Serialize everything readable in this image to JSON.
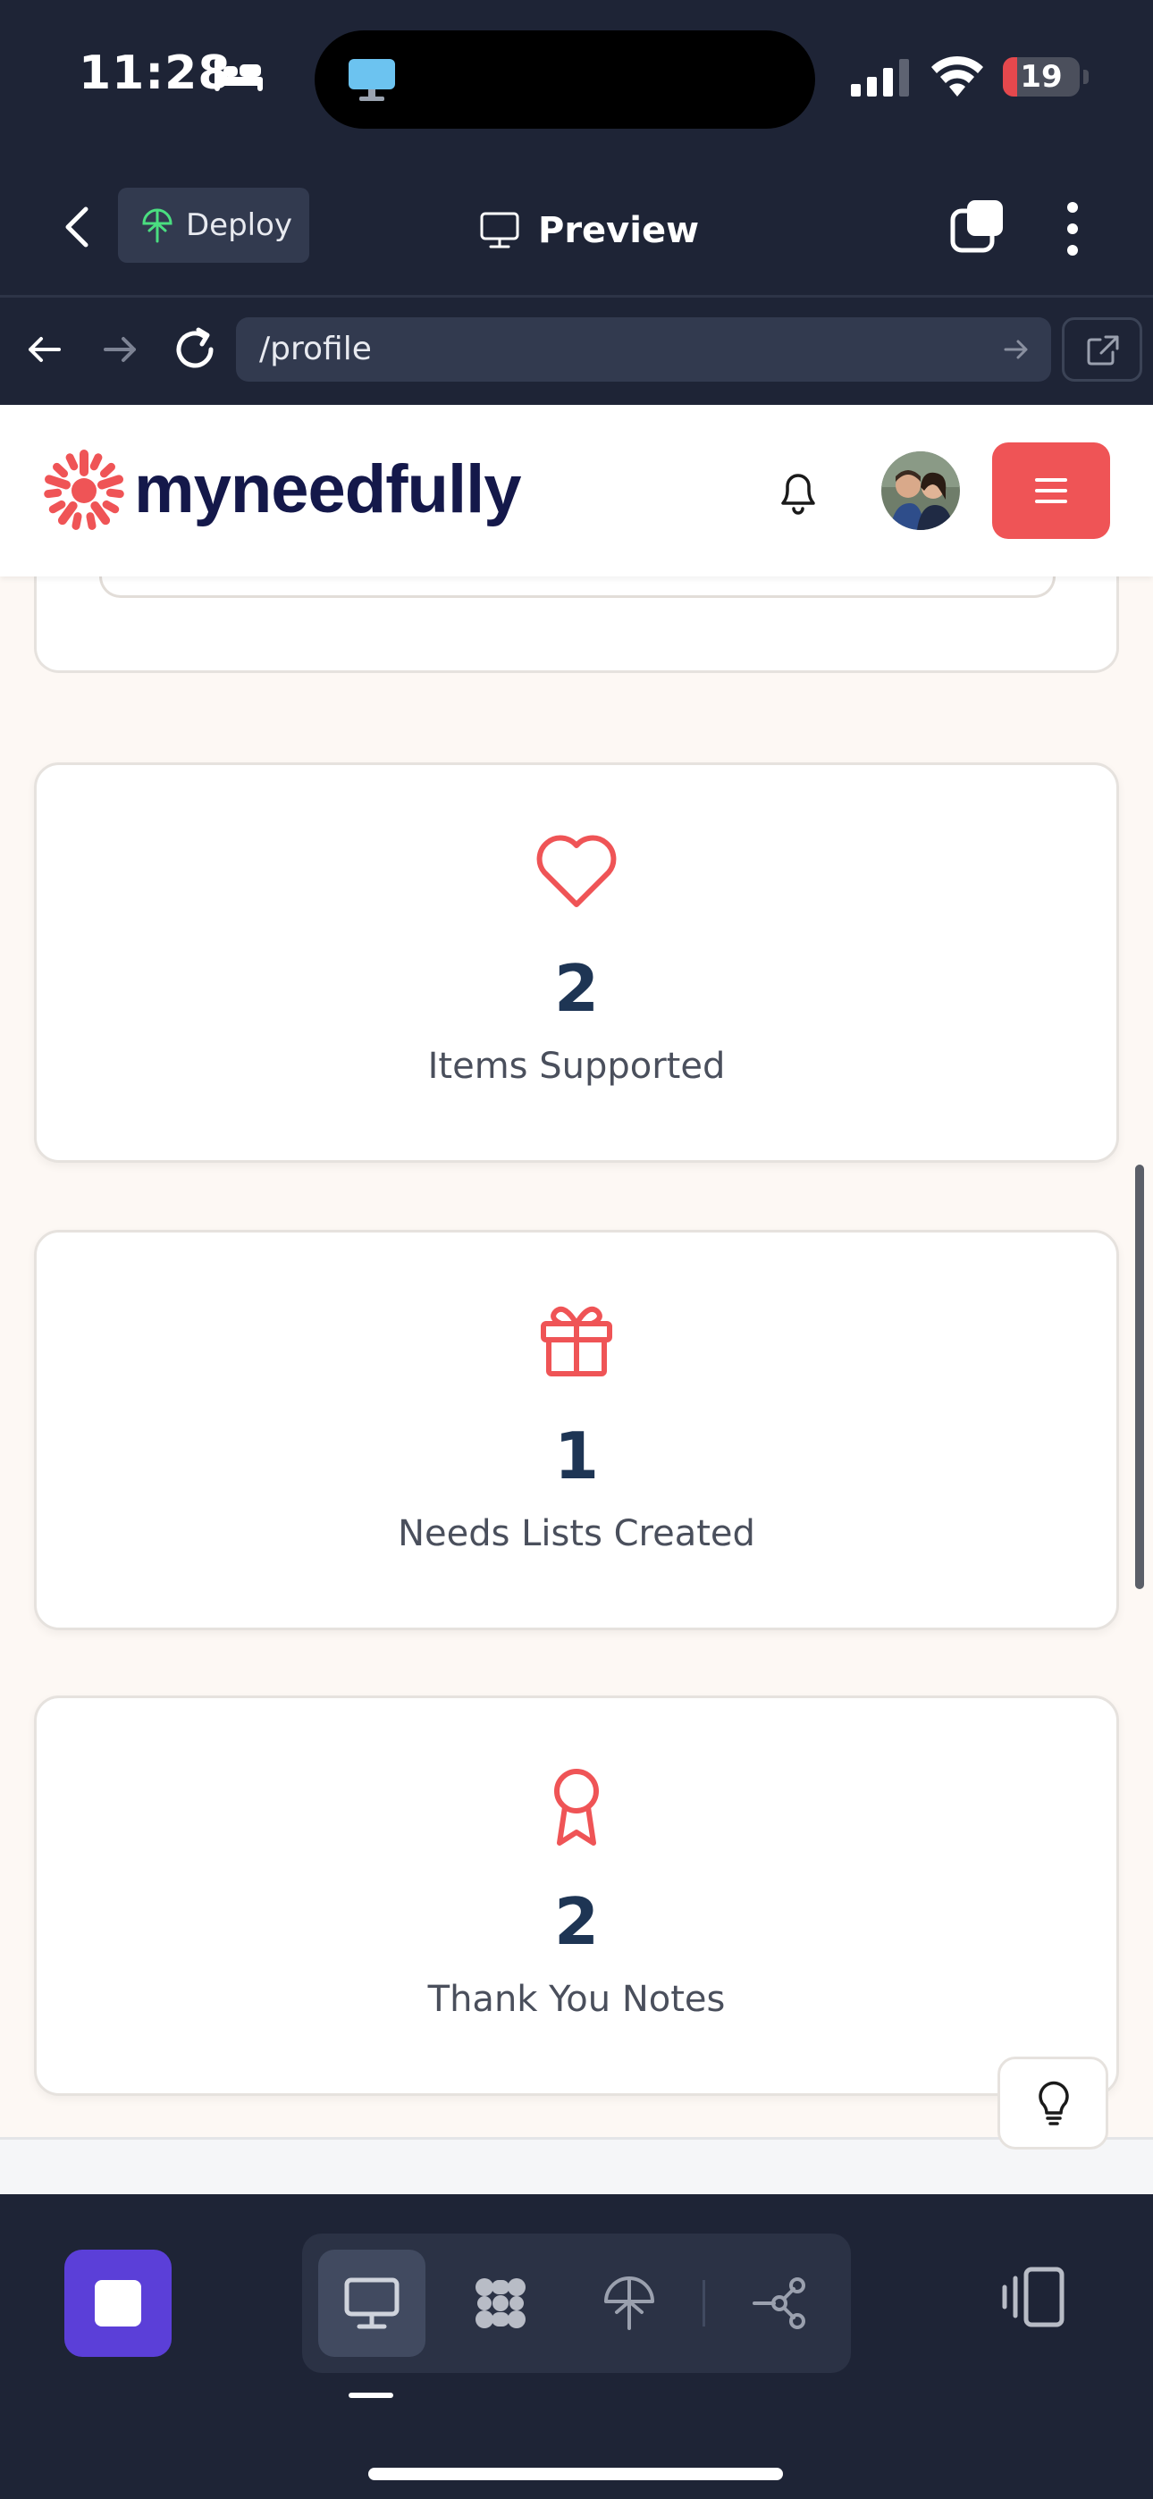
{
  "status_bar": {
    "time": "11:28",
    "battery": "19",
    "battery_fraction": 0.19
  },
  "app_bar": {
    "deploy_label": "Deploy",
    "preview_label": "Preview"
  },
  "url_bar": {
    "url": "/profile"
  },
  "site": {
    "logo_text": "myneedfully"
  },
  "stats": [
    {
      "icon": "heart-icon",
      "value": "2",
      "label": "Items Supported"
    },
    {
      "icon": "gift-icon",
      "value": "1",
      "label": "Needs Lists Created"
    },
    {
      "icon": "award-icon",
      "value": "2",
      "label": "Thank You Notes"
    }
  ],
  "colors": {
    "accent": "#ef5456",
    "navy": "#1e3554",
    "chrome": "#1e2436",
    "stop_button": "#5b3fd8",
    "page_bg": "#fdf8f4"
  }
}
